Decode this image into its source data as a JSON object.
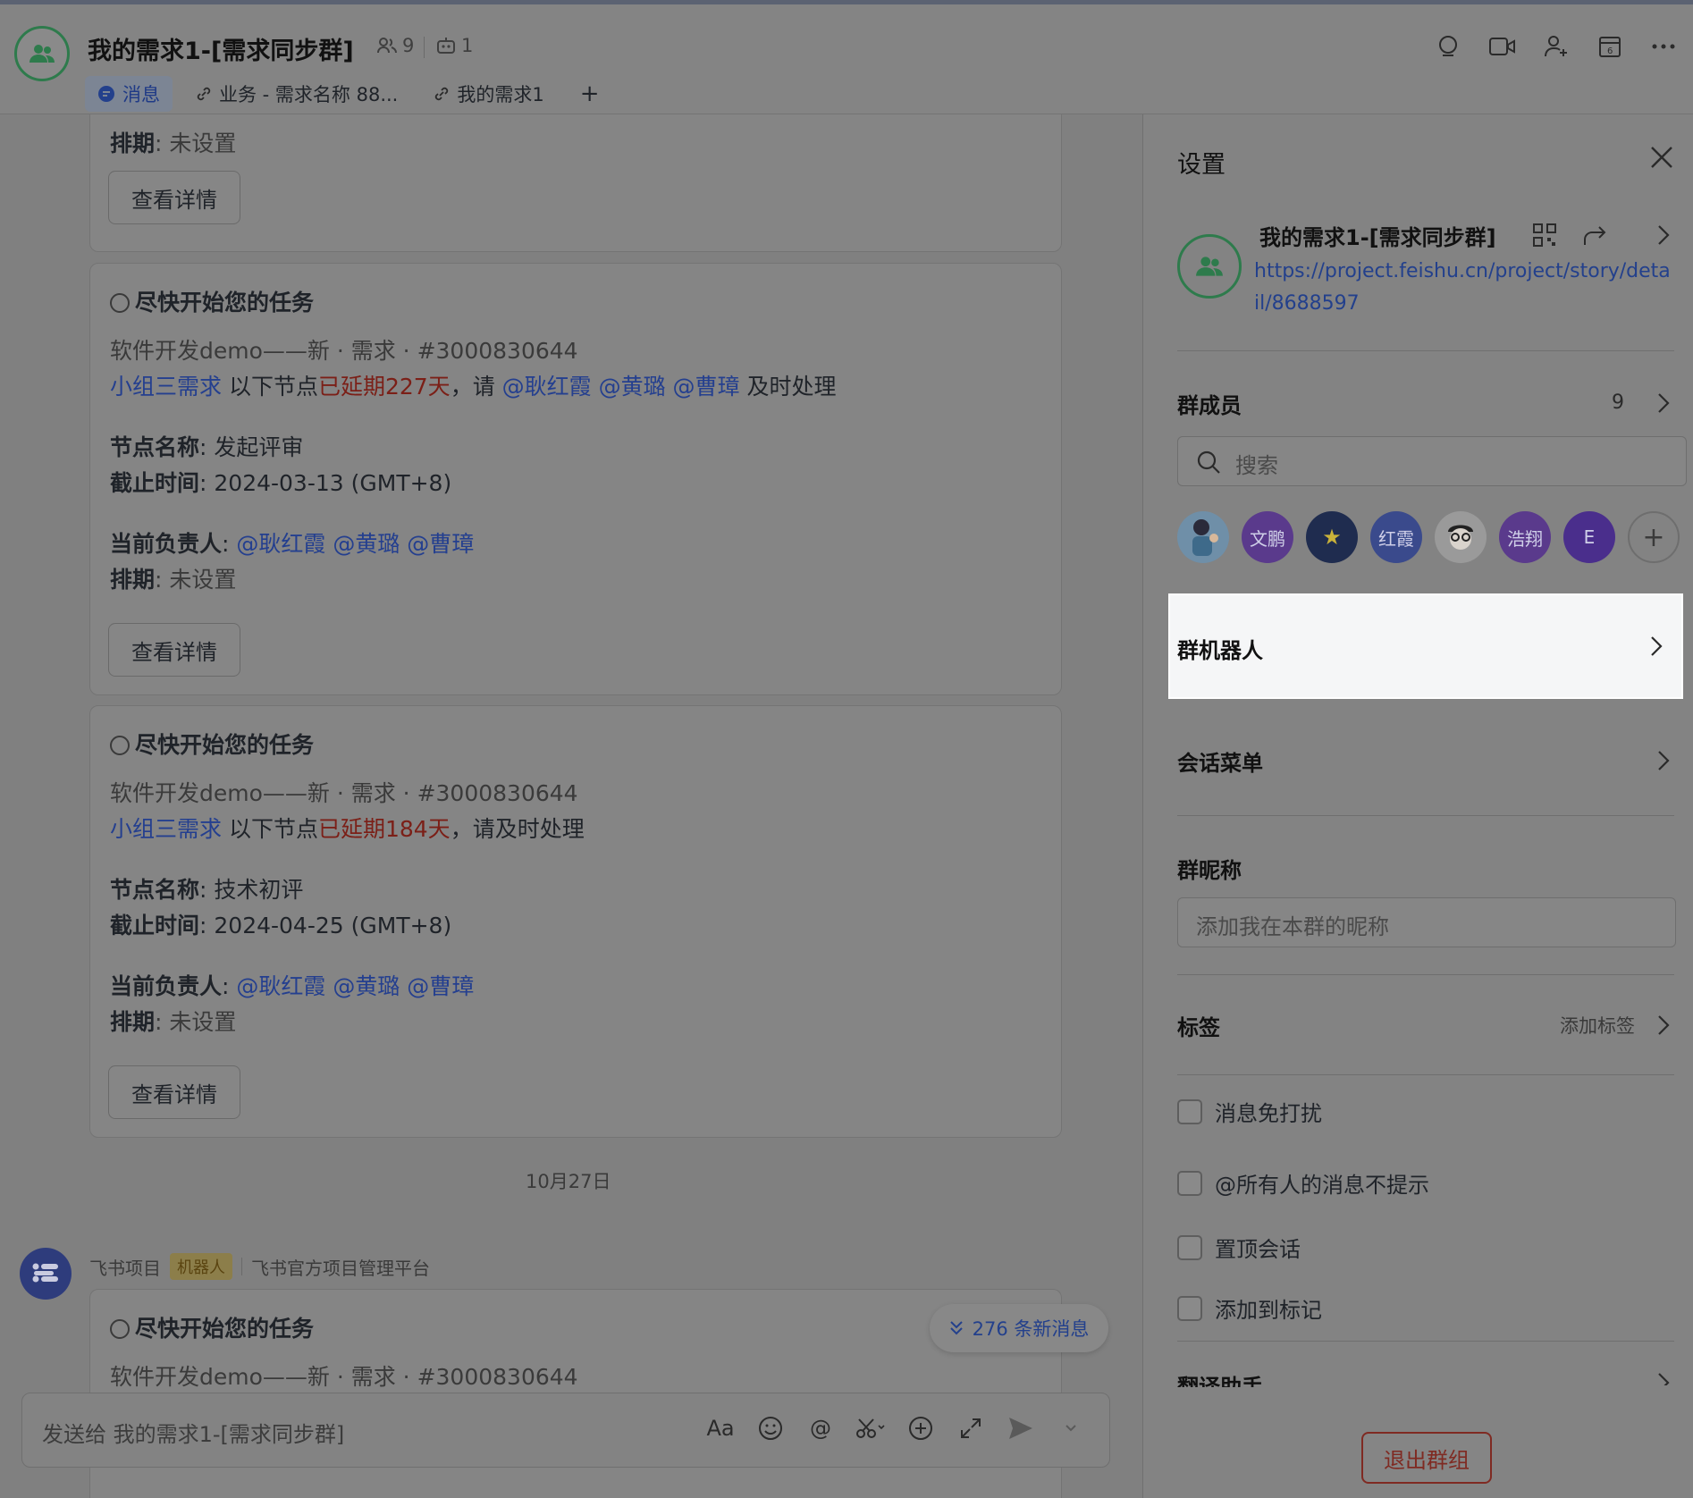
{
  "header": {
    "title": "我的需求1-[需求同步群]",
    "member_count": "9",
    "bot_count": "1",
    "tabs": [
      {
        "label": "消息"
      },
      {
        "label": "业务 - 需求名称 88..."
      },
      {
        "label": "我的需求1"
      }
    ],
    "add_tab": "+"
  },
  "chat": {
    "top_card": {
      "schedule_label": "排期",
      "schedule_value": ": 未设置",
      "detail_button": "查看详情"
    },
    "cards": [
      {
        "heading": "尽快开始您的任务",
        "project": "软件开发demo——新 · 需求 · #3000830644",
        "group_link": "小组三需求",
        "pre_delay": " 以下节点",
        "delay": "已延期227天",
        "request": "，请 ",
        "mentions": "@耿红霞 @黄璐 @曹璋",
        "tail": " 及时处理",
        "node_label": "节点名称",
        "node_value": ": 发起评审",
        "deadline_label": "截止时间",
        "deadline_value": ": 2024-03-13 (GMT+8)",
        "owner_label": "当前负责人",
        "owner_sep": ": ",
        "owner_mentions": "@耿红霞 @黄璐 @曹璋",
        "schedule_label": "排期",
        "schedule_value": ": 未设置",
        "detail_button": "查看详情"
      },
      {
        "heading": "尽快开始您的任务",
        "project": "软件开发demo——新 · 需求 · #3000830644",
        "group_link": "小组三需求",
        "pre_delay": " 以下节点",
        "delay": "已延期184天",
        "request": "，请及时处理",
        "node_label": "节点名称",
        "node_value": ": 技术初评",
        "deadline_label": "截止时间",
        "deadline_value": ": 2024-04-25 (GMT+8)",
        "owner_label": "当前负责人",
        "owner_sep": ": ",
        "owner_mentions": "@耿红霞 @黄璐 @曹璋",
        "schedule_label": "排期",
        "schedule_value": ": 未设置",
        "detail_button": "查看详情"
      }
    ],
    "date_separator": "10月27日",
    "bot": {
      "name": "飞书项目",
      "badge": "机器人",
      "org": "飞书官方项目管理平台"
    },
    "last_card": {
      "heading": "尽快开始您的任务",
      "project": "软件开发demo——新 · 需求 · #3000830644"
    },
    "new_messages": "276 条新消息",
    "input_placeholder": "发送给 我的需求1-[需求同步群]"
  },
  "panel": {
    "title": "设置",
    "group_name": "我的需求1-[需求同步群]",
    "group_link": "https://project.feishu.cn/project/story/detail/8688597",
    "members_title": "群成员",
    "members_count": "9",
    "search_placeholder": "搜索",
    "members": [
      {
        "label": "",
        "color": "#6f8fa8"
      },
      {
        "label": "文鹏",
        "color": "#5a3a8c"
      },
      {
        "label": "★",
        "color": "#1f2c4f"
      },
      {
        "label": "红霞",
        "color": "#3a4a8c"
      },
      {
        "label": "",
        "color": "#9a9a9a"
      },
      {
        "label": "浩翔",
        "color": "#5a3a8c"
      },
      {
        "label": "E",
        "color": "#4a2e8c"
      }
    ],
    "add_member": "+",
    "bots_row": "群机器人",
    "menu_row": "会话菜单",
    "nickname_title": "群昵称",
    "nickname_placeholder": "添加我在本群的昵称",
    "tags_title": "标签",
    "tags_action": "添加标签",
    "checks": [
      {
        "label": "消息免打扰"
      },
      {
        "label": "@所有人的消息不提示"
      },
      {
        "label": "置顶会话"
      },
      {
        "label": "添加到标记"
      }
    ],
    "translate_row": "翻译助手",
    "exit_button": "退出群组"
  }
}
